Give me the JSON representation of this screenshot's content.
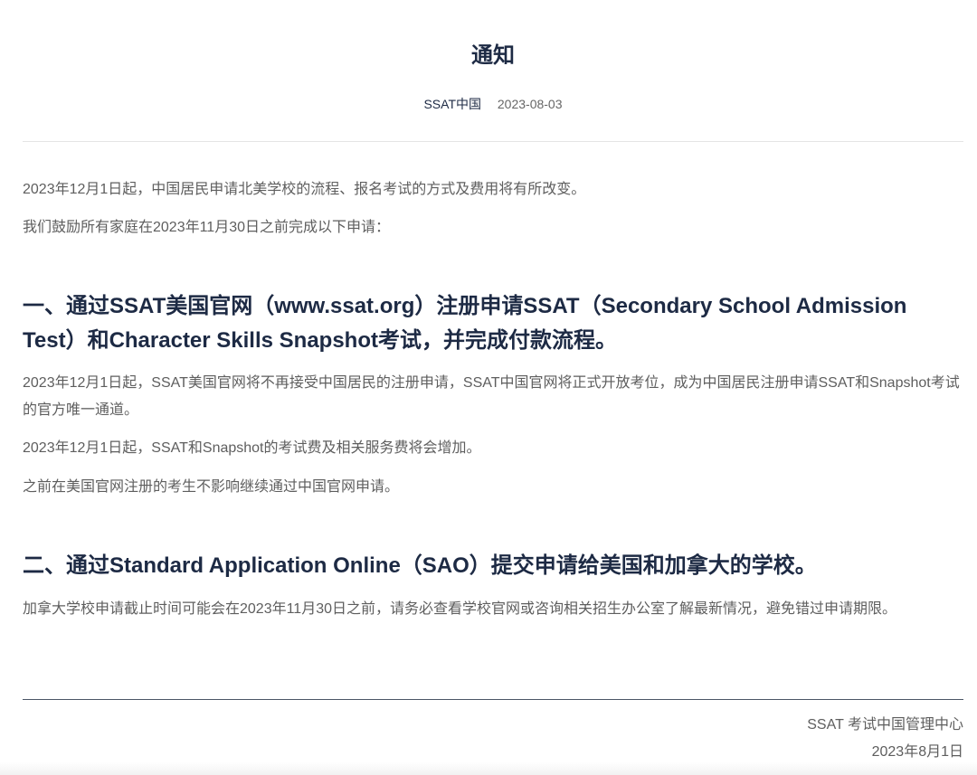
{
  "header": {
    "title": "通知",
    "source": "SSAT中国",
    "date": "2023-08-03"
  },
  "intro": [
    "2023年12月1日起，中国居民申请北美学校的流程、报名考试的方式及费用将有所改变。",
    "我们鼓励所有家庭在2023年11月30日之前完成以下申请："
  ],
  "section1": {
    "heading": "一、通过SSAT美国官网（www.ssat.org）注册申请SSAT（Secondary School Admission Test）和Character Skills Snapshot考试，并完成付款流程。",
    "paragraphs": [
      "2023年12月1日起，SSAT美国官网将不再接受中国居民的注册申请，SSAT中国官网将正式开放考位，成为中国居民注册申请SSAT和Snapshot考试的官方唯一通道。",
      "2023年12月1日起，SSAT和Snapshot的考试费及相关服务费将会增加。",
      "之前在美国官网注册的考生不影响继续通过中国官网申请。"
    ]
  },
  "section2": {
    "heading": "二、通过Standard Application Online（SAO）提交申请给美国和加拿大的学校。",
    "paragraphs": [
      "加拿大学校申请截止时间可能会在2023年11月30日之前，请务必查看学校官网或咨询相关招生办公室了解最新情况，避免错过申请期限。"
    ]
  },
  "footer": {
    "organization": "SSAT 考试中国管理中心",
    "date": "2023年8月1日"
  }
}
